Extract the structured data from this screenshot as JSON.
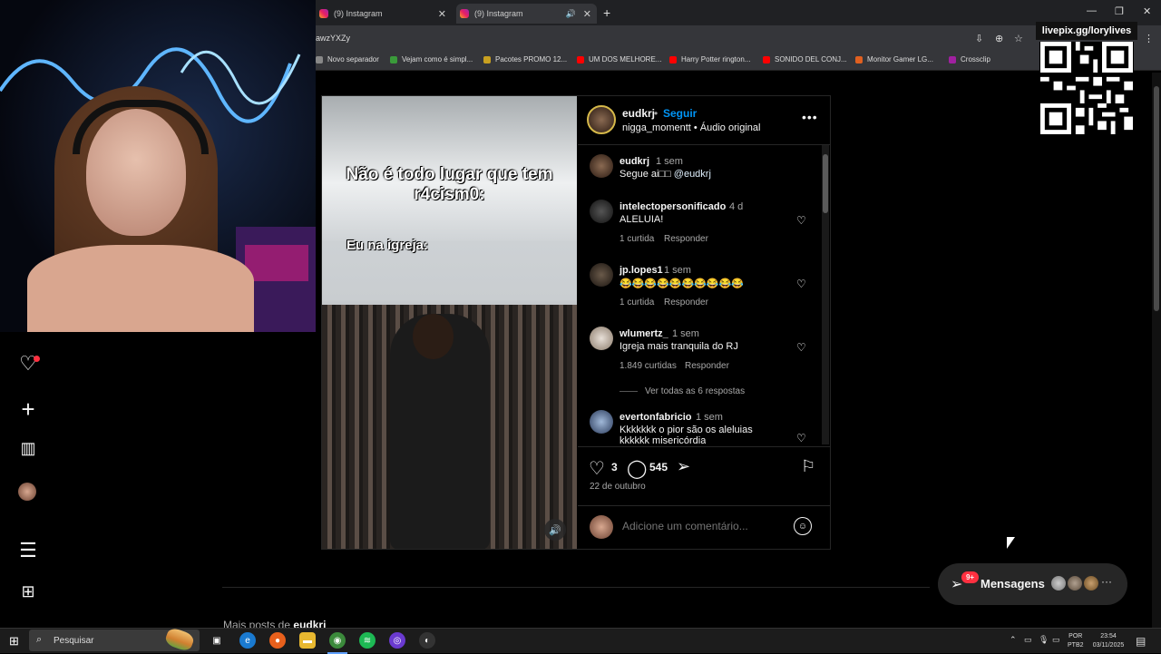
{
  "browser": {
    "tabs": [
      {
        "title": "(9) Instagram"
      },
      {
        "title": "(9) Instagram"
      }
    ],
    "url_fragment": "awzYXZy",
    "bookmarks": [
      {
        "label": "Novo separador",
        "color": "#888888"
      },
      {
        "label": "Vejam como é simpl...",
        "color": "#3a9a3a"
      },
      {
        "label": "Pacotes PROMO 12...",
        "color": "#c8a020"
      },
      {
        "label": "UM DOS MELHORE...",
        "color": "#ff0000"
      },
      {
        "label": "Harry Potter rington...",
        "color": "#ff0000"
      },
      {
        "label": "SONIDO DEL CONJ...",
        "color": "#ff0000"
      },
      {
        "label": "Monitor Gamer LG...",
        "color": "#e06020"
      },
      {
        "label": "Crossclip",
        "color": "#a020a0"
      }
    ]
  },
  "overlay": {
    "live_label": "livepix.gg/lorylives"
  },
  "video": {
    "caption_top": "Não é todo lugar que tem r4cism0:",
    "caption_bottom": "Eu na igreja:"
  },
  "post": {
    "username": "eudkrj",
    "dot": "•",
    "follow_label": "Seguir",
    "subtitle": "nigga_momentt • Áudio original",
    "likes": "3",
    "comments_count": "545",
    "date": "22 de outubro",
    "comment_placeholder": "Adicione um comentário...",
    "replies_label": "Ver todas as 6 respostas"
  },
  "comments": [
    {
      "user": "eudkrj",
      "time": "1 sem",
      "text": "Segue ai□□",
      "mention": "@eudkrj",
      "likes": "",
      "reply": ""
    },
    {
      "user": "intelectopersonificado",
      "time": "4 d",
      "text": "ALELUIA!",
      "likes": "1 curtida",
      "reply": "Responder"
    },
    {
      "user": "jp.lopes1",
      "time": "1 sem",
      "text": "😂😂😂😂😂😂😂😂😂😂",
      "likes": "1 curtida",
      "reply": "Responder"
    },
    {
      "user": "wlumertz_",
      "time": "1 sem",
      "text": "Igreja mais tranquila do RJ",
      "likes": "1.849 curtidas",
      "reply": "Responder"
    },
    {
      "user": "evertonfabricio",
      "time": "1 sem",
      "text": "Kkkkkkk o pior são os aleluias",
      "text2": "kkkkkk misericórdia"
    }
  ],
  "more_posts": {
    "prefix": "Mais posts de",
    "user": "eudkrj"
  },
  "messages": {
    "badge": "9+",
    "label": "Mensagens"
  },
  "taskbar": {
    "search_label": "Pesquisar",
    "lang_top": "POR",
    "lang_bottom": "PTB2",
    "time": "23:54",
    "date": "03/11/2025"
  }
}
